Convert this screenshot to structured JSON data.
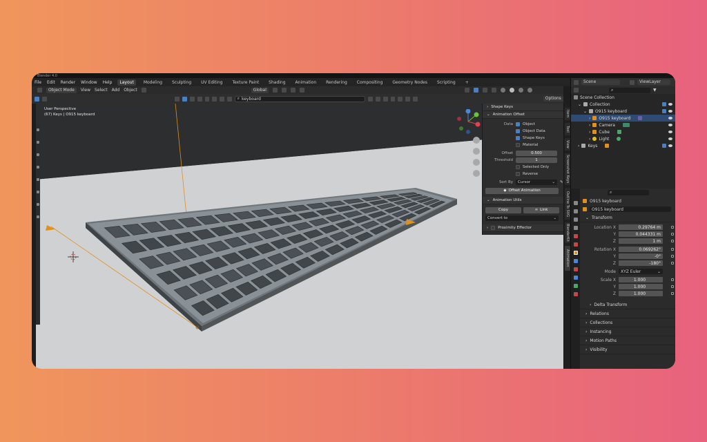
{
  "app": {
    "title": "Blender 4.0"
  },
  "menubar": {
    "menus": [
      "File",
      "Edit",
      "Render",
      "Window",
      "Help"
    ],
    "tabs": [
      "Layout",
      "Modeling",
      "Sculpting",
      "UV Editing",
      "Texture Paint",
      "Shading",
      "Animation",
      "Rendering",
      "Compositing",
      "Geometry Nodes",
      "Scripting"
    ],
    "active_tab": "Layout",
    "add_tab": "+"
  },
  "header": {
    "mode": "Object Mode",
    "menus": [
      "View",
      "Select",
      "Add",
      "Object"
    ],
    "transform_orientation": "Global",
    "options": "Options"
  },
  "search": {
    "value": "keyboard"
  },
  "viewport": {
    "perspective": "User Perspective",
    "selection_info": "(67) Keys | O915 keyboard"
  },
  "npanel": {
    "shape_keys": "Shape Keys",
    "animation_offset": "Animation Offset",
    "data_label": "Data",
    "checks": [
      {
        "label": "Object",
        "checked": true
      },
      {
        "label": "Object Data",
        "checked": true
      },
      {
        "label": "Shape Keys",
        "checked": true
      },
      {
        "label": "Material",
        "checked": false
      }
    ],
    "offset_label": "Offset",
    "offset_value": "0.500",
    "threshold_label": "Threshold",
    "threshold_value": "1",
    "checks2": [
      {
        "label": "Selected Only",
        "checked": false
      },
      {
        "label": "Reverse",
        "checked": false
      }
    ],
    "sort_by_label": "Sort By",
    "sort_by_value": "Cursor",
    "offset_animation": "Offset Animation",
    "animation_utils": "Animation Utils",
    "copy": "Copy",
    "link": "Link",
    "convert_to": "Convert to",
    "proximity_effector": "Proximity Effector"
  },
  "sidetabs": [
    "Item",
    "Tool",
    "View",
    "Screenshot Keys",
    "Outline To SVG",
    "BlenderKit",
    "Animation"
  ],
  "outliner": {
    "scene": "Scene",
    "view_layer": "ViewLayer",
    "rows": [
      {
        "label": "Scene Collection",
        "indent": 0
      },
      {
        "label": "Collection",
        "indent": 1
      },
      {
        "label": "O915 keyboard",
        "indent": 2
      },
      {
        "label": "O915 keyboard",
        "indent": 3,
        "selected": true
      },
      {
        "label": "Camera",
        "indent": 2
      },
      {
        "label": "Cube",
        "indent": 2
      },
      {
        "label": "Light",
        "indent": 2
      },
      {
        "label": "Keys",
        "indent": 1
      }
    ]
  },
  "properties": {
    "object_name": "O915 keyboard",
    "data_name": "O915 keyboard",
    "transform": "Transform",
    "location": [
      {
        "label": "Location X",
        "value": "0.29764 m"
      },
      {
        "label": "Y",
        "value": "0.044331 m"
      },
      {
        "label": "Z",
        "value": "1 m"
      }
    ],
    "rotation": [
      {
        "label": "Rotation X",
        "value": "0.069262°"
      },
      {
        "label": "Y",
        "value": "-0°"
      },
      {
        "label": "Z",
        "value": "-180°"
      }
    ],
    "mode_label": "Mode",
    "mode_value": "XYZ Euler",
    "scale": [
      {
        "label": "Scale X",
        "value": "1.000"
      },
      {
        "label": "Y",
        "value": "1.000"
      },
      {
        "label": "Z",
        "value": "1.000"
      }
    ],
    "sections": [
      "Delta Transform",
      "Relations",
      "Collections",
      "Instancing",
      "Motion Paths",
      "Visibility"
    ]
  },
  "colors": {
    "accent": "#4a7fc0",
    "selection_row": "#2f4a73",
    "gizmo_x": "#e0404f",
    "gizmo_y": "#6ac13e",
    "gizmo_z": "#4b86d8"
  }
}
